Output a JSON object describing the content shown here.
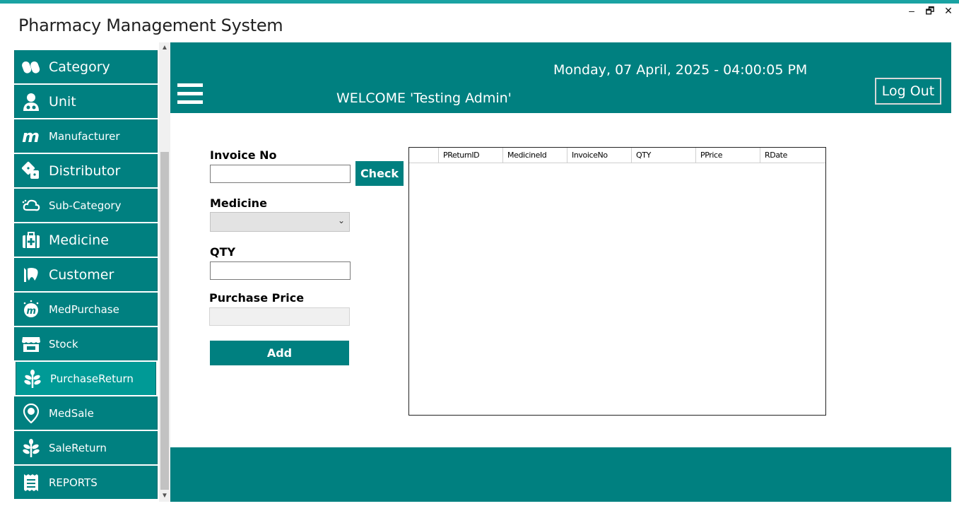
{
  "app": {
    "title": "Pharmacy Management System"
  },
  "window_controls": {
    "minimize": "–",
    "restore": "🗗",
    "close": "✕"
  },
  "sidebar": {
    "items": [
      {
        "label": "Category",
        "icon": "pills-icon"
      },
      {
        "label": "Unit",
        "icon": "doctor-icon"
      },
      {
        "label": "Manufacturer",
        "icon": "m-logo-icon"
      },
      {
        "label": "Distributor",
        "icon": "dice-icon"
      },
      {
        "label": "Sub-Category",
        "icon": "cloud-icon"
      },
      {
        "label": "Medicine",
        "icon": "medkit-icon"
      },
      {
        "label": "Customer",
        "icon": "tooth-icon"
      },
      {
        "label": "MedPurchase",
        "icon": "medpurchase-icon"
      },
      {
        "label": "Stock",
        "icon": "store-icon"
      },
      {
        "label": "PurchaseReturn",
        "icon": "leaf-icon",
        "active": true
      },
      {
        "label": "MedSale",
        "icon": "location-pin-icon"
      },
      {
        "label": "SaleReturn",
        "icon": "leaf-icon"
      },
      {
        "label": "REPORTS",
        "icon": "receipt-icon"
      }
    ]
  },
  "header": {
    "datetime": "Monday, 07 April, 2025 - 04:00:05 PM",
    "welcome": "WELCOME 'Testing Admin'",
    "logout_label": "Log Out"
  },
  "form": {
    "invoice_label": "Invoice No",
    "invoice_value": "",
    "check_label": "Check",
    "medicine_label": "Medicine",
    "medicine_value": "",
    "qty_label": "QTY",
    "qty_value": "",
    "purchase_price_label": "Purchase Price",
    "purchase_price_value": "",
    "add_label": "Add"
  },
  "grid": {
    "columns": [
      "PReturnID",
      "MedicineId",
      "InvoiceNo",
      "QTY",
      "PPrice",
      "RDate"
    ],
    "rows": []
  },
  "colors": {
    "teal": "#008080",
    "active_teal": "#009a96",
    "top_line": "#1aa3a3"
  }
}
